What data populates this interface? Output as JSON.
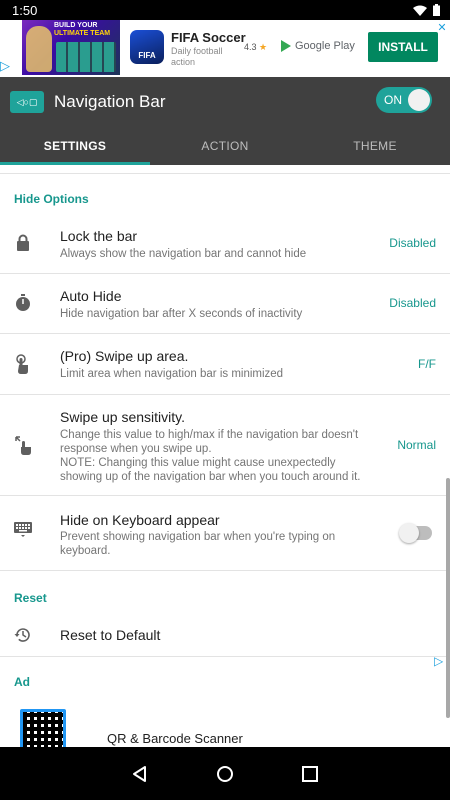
{
  "status_bar": {
    "time": "1:50"
  },
  "top_ad": {
    "thumb_text_1": "BUILD YOUR",
    "thumb_text_2": "ULTIMATE TEAM",
    "app_icon_text": "FIFA",
    "title": "FIFA Soccer",
    "subtitle": "Daily football action",
    "rating": "4.3",
    "store": "Google Play",
    "install_label": "INSTALL"
  },
  "app_bar": {
    "title": "Navigation Bar",
    "switch_label": "ON",
    "tabs": [
      {
        "label": "SETTINGS"
      },
      {
        "label": "ACTION"
      },
      {
        "label": "THEME"
      }
    ]
  },
  "sections": {
    "hide_options": "Hide Options",
    "reset": "Reset",
    "ad": "Ad"
  },
  "prefs": {
    "lock": {
      "title": "Lock the bar",
      "summary": "Always show the navigation bar and cannot hide",
      "value": "Disabled"
    },
    "auto_hide": {
      "title": "Auto Hide",
      "summary": "Hide navigation bar after X seconds of inactivity",
      "value": "Disabled"
    },
    "swipe_area": {
      "title": "(Pro) Swipe up area.",
      "summary": "Limit area when navigation bar is minimized",
      "value": "F/F"
    },
    "swipe_sensitivity": {
      "title": "Swipe up sensitivity.",
      "summary": "Change this value to high/max if the navigation bar doesn't response when you swipe up.",
      "note": "NOTE: Changing this value might cause unexpectedly showing up of the navigation bar when you touch around it.",
      "value": "Normal"
    },
    "keyboard": {
      "title": "Hide on Keyboard appear",
      "summary": "Prevent showing navigation bar when you're typing on keyboard."
    },
    "reset_default": {
      "title": "Reset to Default"
    }
  },
  "bottom_ad": {
    "title": "QR & Barcode Scanner"
  },
  "colors": {
    "accent": "#1fa39a",
    "app_bar": "#404040",
    "install": "#01875f"
  }
}
